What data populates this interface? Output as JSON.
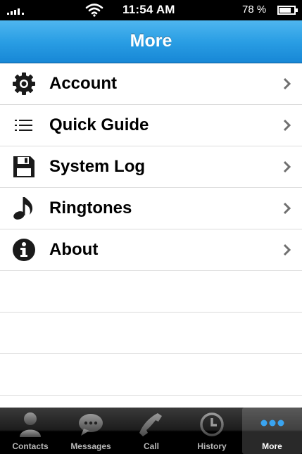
{
  "status_bar": {
    "time": "11:54 AM",
    "battery_percent": "78 %",
    "battery_level": 0.78
  },
  "nav_bar": {
    "title": "More"
  },
  "menu": {
    "items": [
      {
        "label": "Account",
        "icon": "gear-icon"
      },
      {
        "label": "Quick Guide",
        "icon": "list-icon"
      },
      {
        "label": "System Log",
        "icon": "floppy-disk-icon"
      },
      {
        "label": "Ringtones",
        "icon": "music-note-icon"
      },
      {
        "label": "About",
        "icon": "info-icon"
      }
    ]
  },
  "tab_bar": {
    "tabs": [
      {
        "label": "Contacts",
        "icon": "person-icon"
      },
      {
        "label": "Messages",
        "icon": "speech-bubble-icon"
      },
      {
        "label": "Call",
        "icon": "phone-icon"
      },
      {
        "label": "History",
        "icon": "clock-icon"
      },
      {
        "label": "More",
        "icon": "more-dots-icon",
        "active": true
      }
    ]
  },
  "colors": {
    "nav_bar": "#2a9ee4",
    "tab_active_dots": "#3aa4f0"
  }
}
